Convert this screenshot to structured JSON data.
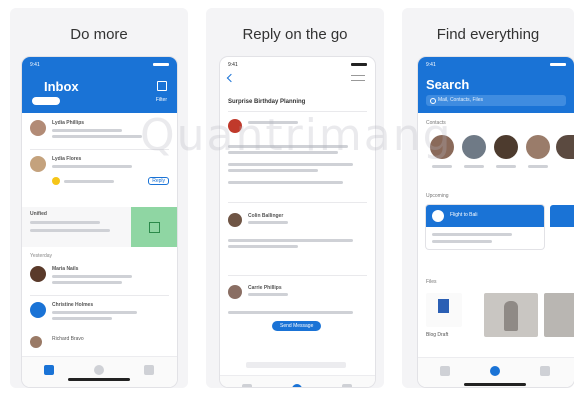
{
  "captions": [
    "Do more",
    "Reply on the go",
    "Find everything"
  ],
  "screen1": {
    "time": "9:41",
    "title": "Inbox",
    "filter": "Filter",
    "rows": [
      {
        "sender": "Lydia Phillips"
      },
      {
        "sender": "Lydia Flores"
      }
    ],
    "unified_label": "Unified",
    "meeting_action": "Reply",
    "section": "Yesterday",
    "rows2": [
      {
        "sender": "Maria Nails"
      },
      {
        "sender": "Christine Holmes"
      },
      {
        "sender": "Richard Bravo"
      }
    ]
  },
  "screen2": {
    "time": "9:41",
    "subject": "Surprise Birthday Planning",
    "senders": [
      "Colin Ballinger",
      "Carrie Phillips"
    ],
    "quick_reply": "Send Message"
  },
  "screen3": {
    "time": "9:41",
    "title": "Search",
    "search_placeholder": "Mail, Contacts, Files",
    "people_label": "Contacts",
    "upcoming_label": "Upcoming",
    "event_title": "Flight to Bali",
    "files_label": "Files",
    "file_name": "Blog Draft",
    "people_colors": [
      "#8a6a5a",
      "#6f7a86",
      "#4d3b2e",
      "#9a7c6a",
      "#5b4a40"
    ]
  },
  "colors": {
    "accent": "#1a73d6",
    "panel": "#f4f4f6"
  },
  "watermark": "Quantrimang"
}
